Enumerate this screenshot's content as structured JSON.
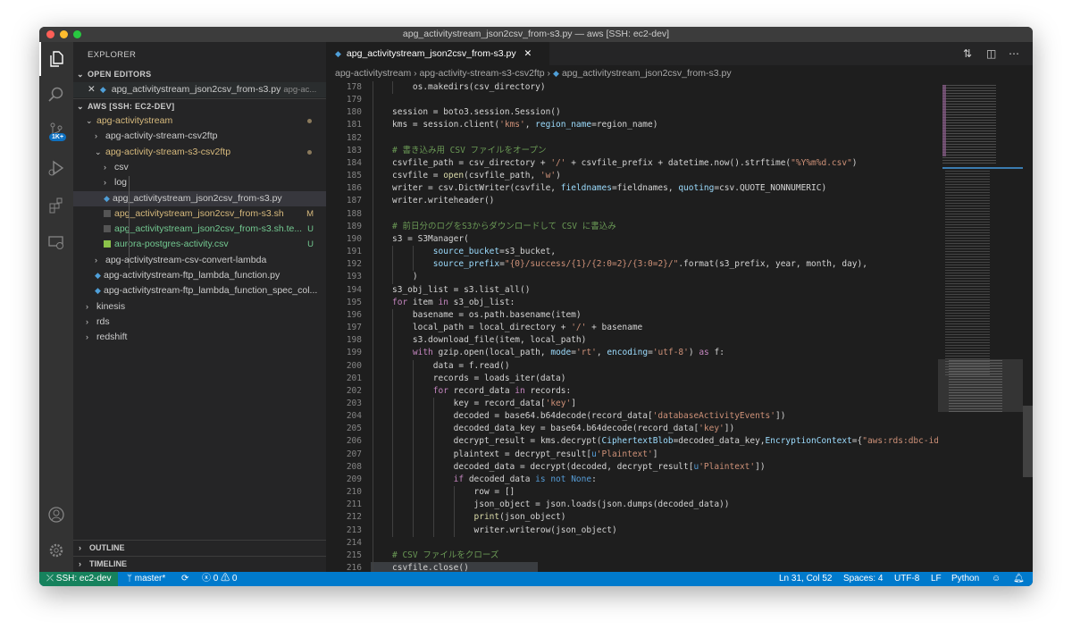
{
  "window": {
    "title": "apg_activitystream_json2csv_from-s3.py — aws [SSH: ec2-dev]"
  },
  "activity_bar": {
    "items": [
      {
        "name": "explorer-icon",
        "active": true
      },
      {
        "name": "search-icon"
      },
      {
        "name": "source-control-icon",
        "badge": "1K+"
      },
      {
        "name": "run-debug-icon"
      },
      {
        "name": "extensions-icon"
      },
      {
        "name": "remote-explorer-icon"
      }
    ],
    "bottom": [
      {
        "name": "account-icon"
      },
      {
        "name": "settings-gear-icon"
      }
    ]
  },
  "sidebar": {
    "title": "EXPLORER",
    "open_editors": {
      "label": "OPEN EDITORS",
      "items": [
        {
          "name": "apg_activitystream_json2csv_from-s3.py",
          "desc": "apg-ac..."
        }
      ]
    },
    "workspace": {
      "label": "AWS [SSH: EC2-DEV]"
    },
    "tree": [
      {
        "label": "apg-activitystream",
        "indent": 1,
        "type": "folder-open",
        "color": "yellow",
        "dot": true
      },
      {
        "label": "apg-activity-stream-csv2ftp",
        "indent": 2,
        "type": "folder"
      },
      {
        "label": "apg-activity-stream-s3-csv2ftp",
        "indent": 2,
        "type": "folder-open",
        "color": "yellow",
        "dot": true
      },
      {
        "label": "csv",
        "indent": 3,
        "type": "folder"
      },
      {
        "label": "log",
        "indent": 3,
        "type": "folder"
      },
      {
        "label": "apg_activitystream_json2csv_from-s3.py",
        "indent": 3,
        "type": "py",
        "selected": true
      },
      {
        "label": "apg_activitystream_json2csv_from-s3.sh",
        "indent": 3,
        "type": "sh",
        "color": "yellow",
        "deco": "M"
      },
      {
        "label": "apg_activitystream_json2csv_from-s3.sh.te...",
        "indent": 3,
        "type": "sh",
        "color": "green",
        "deco": "U"
      },
      {
        "label": "aurora-postgres-activity.csv",
        "indent": 3,
        "type": "csv",
        "color": "green",
        "deco": "U"
      },
      {
        "label": "apg-activitystream-csv-convert-lambda",
        "indent": 2,
        "type": "folder"
      },
      {
        "label": "apg-activitystream-ftp_lambda_function.py",
        "indent": 2,
        "type": "py"
      },
      {
        "label": "apg-activitystream-ftp_lambda_function_spec_col...",
        "indent": 2,
        "type": "py"
      },
      {
        "label": "kinesis",
        "indent": 1,
        "type": "folder"
      },
      {
        "label": "rds",
        "indent": 1,
        "type": "folder"
      },
      {
        "label": "redshift",
        "indent": 1,
        "type": "folder"
      }
    ],
    "outline": "OUTLINE",
    "timeline": "TIMELINE"
  },
  "editor": {
    "tab": {
      "label": "apg_activitystream_json2csv_from-s3.py"
    },
    "actions": [
      {
        "name": "open-changes-icon"
      },
      {
        "name": "split-editor-icon"
      },
      {
        "name": "more-actions-icon"
      }
    ],
    "breadcrumb": [
      "apg-activitystream",
      "apg-activity-stream-s3-csv2ftp",
      "apg_activitystream_json2csv_from-s3.py"
    ],
    "lines": [
      {
        "n": "178",
        "t": [
          [
            "",
            "    os.makedirs(csv_directory)"
          ]
        ]
      },
      {
        "n": "179",
        "t": []
      },
      {
        "n": "180",
        "t": [
          [
            "",
            "session = boto3.session.Session()"
          ]
        ]
      },
      {
        "n": "181",
        "t": [
          [
            "",
            "kms = session.client("
          ],
          [
            "s",
            "'kms'"
          ],
          [
            "",
            ", "
          ],
          [
            "p",
            "region_name"
          ],
          [
            "",
            "=region_name)"
          ]
        ]
      },
      {
        "n": "182",
        "t": []
      },
      {
        "n": "183",
        "t": [
          [
            "c",
            "# 書き込み用 CSV ファイルをオープン"
          ]
        ]
      },
      {
        "n": "184",
        "t": [
          [
            "",
            "csvfile_path = csv_directory + "
          ],
          [
            "s",
            "'/'"
          ],
          [
            "",
            " + csvfile_prefix + datetime.now().strftime("
          ],
          [
            "s",
            "\"%Y%m%d.csv\""
          ],
          [
            "",
            ")"
          ]
        ]
      },
      {
        "n": "185",
        "t": [
          [
            "",
            "csvfile = "
          ],
          [
            "f",
            "open"
          ],
          [
            "",
            "(csvfile_path, "
          ],
          [
            "s",
            "'w'"
          ],
          [
            "",
            ")"
          ]
        ]
      },
      {
        "n": "186",
        "t": [
          [
            "",
            "writer = csv.DictWriter(csvfile, "
          ],
          [
            "p",
            "fieldnames"
          ],
          [
            "",
            "=fieldnames, "
          ],
          [
            "p",
            "quoting"
          ],
          [
            "",
            "=csv.QUOTE_NONNUMERIC)"
          ]
        ]
      },
      {
        "n": "187",
        "t": [
          [
            "",
            "writer.writeheader()"
          ]
        ]
      },
      {
        "n": "188",
        "t": []
      },
      {
        "n": "189",
        "t": [
          [
            "c",
            "# 前日分のログをS3からダウンロードして CSV に書込み"
          ]
        ]
      },
      {
        "n": "190",
        "t": [
          [
            "",
            "s3 = S3Manager("
          ]
        ]
      },
      {
        "n": "191",
        "t": [
          [
            "",
            "        "
          ],
          [
            "p",
            "source_bucket"
          ],
          [
            "",
            "=s3_bucket,"
          ]
        ]
      },
      {
        "n": "192",
        "t": [
          [
            "",
            "        "
          ],
          [
            "p",
            "source_prefix"
          ],
          [
            "",
            "="
          ],
          [
            "s",
            "\"{0}/success/{1}/{2:0=2}/{3:0=2}/\""
          ],
          [
            "",
            ".format(s3_prefix, year, month, day),"
          ]
        ]
      },
      {
        "n": "193",
        "t": [
          [
            "",
            "    )"
          ]
        ]
      },
      {
        "n": "194",
        "t": [
          [
            "",
            "s3_obj_list = s3.list_all()"
          ]
        ]
      },
      {
        "n": "195",
        "t": [
          [
            "k",
            "for"
          ],
          [
            "",
            " item "
          ],
          [
            "k",
            "in"
          ],
          [
            "",
            " s3_obj_list:"
          ]
        ]
      },
      {
        "n": "196",
        "t": [
          [
            "",
            "    basename = os.path.basename(item)"
          ]
        ]
      },
      {
        "n": "197",
        "t": [
          [
            "",
            "    local_path = local_directory + "
          ],
          [
            "s",
            "'/'"
          ],
          [
            "",
            " + basename"
          ]
        ]
      },
      {
        "n": "198",
        "t": [
          [
            "",
            "    s3.download_file(item, local_path)"
          ]
        ]
      },
      {
        "n": "199",
        "t": [
          [
            "",
            "    "
          ],
          [
            "k",
            "with"
          ],
          [
            "",
            " gzip.open(local_path, "
          ],
          [
            "p",
            "mode"
          ],
          [
            "",
            "="
          ],
          [
            "s",
            "'rt'"
          ],
          [
            "",
            ", "
          ],
          [
            "p",
            "encoding"
          ],
          [
            "",
            "="
          ],
          [
            "s",
            "'utf-8'"
          ],
          [
            "",
            ") "
          ],
          [
            "k",
            "as"
          ],
          [
            "",
            " f:"
          ]
        ]
      },
      {
        "n": "200",
        "t": [
          [
            "",
            "        data = f.read()"
          ]
        ]
      },
      {
        "n": "201",
        "t": [
          [
            "",
            "        records = loads_iter(data)"
          ]
        ]
      },
      {
        "n": "202",
        "t": [
          [
            "",
            "        "
          ],
          [
            "k",
            "for"
          ],
          [
            "",
            " record_data "
          ],
          [
            "k",
            "in"
          ],
          [
            "",
            " records:"
          ]
        ]
      },
      {
        "n": "203",
        "t": [
          [
            "",
            "            key = record_data["
          ],
          [
            "s",
            "'key'"
          ],
          [
            "",
            "]"
          ]
        ]
      },
      {
        "n": "204",
        "t": [
          [
            "",
            "            decoded = base64.b64decode(record_data["
          ],
          [
            "s",
            "'databaseActivityEvents'"
          ],
          [
            "",
            "])"
          ]
        ]
      },
      {
        "n": "205",
        "t": [
          [
            "",
            "            decoded_data_key = base64.b64decode(record_data["
          ],
          [
            "s",
            "'key'"
          ],
          [
            "",
            "])"
          ]
        ]
      },
      {
        "n": "206",
        "t": [
          [
            "",
            "            decrypt_result = kms.decrypt("
          ],
          [
            "p",
            "CiphertextBlob"
          ],
          [
            "",
            "=decoded_data_key,"
          ],
          [
            "p",
            "EncryptionContext"
          ],
          [
            "",
            "={"
          ],
          [
            "s",
            "\"aws:rds:dbc-id\""
          ]
        ]
      },
      {
        "n": "207",
        "t": [
          [
            "",
            "            plaintext = decrypt_result["
          ],
          [
            "b",
            "u"
          ],
          [
            "s",
            "'Plaintext'"
          ],
          [
            "",
            "]"
          ]
        ]
      },
      {
        "n": "208",
        "t": [
          [
            "",
            "            decoded_data = decrypt(decoded, decrypt_result["
          ],
          [
            "b",
            "u"
          ],
          [
            "s",
            "'Plaintext'"
          ],
          [
            "",
            "])"
          ]
        ]
      },
      {
        "n": "209",
        "t": [
          [
            "",
            "            "
          ],
          [
            "k",
            "if"
          ],
          [
            "",
            " decoded_data "
          ],
          [
            "b",
            "is not None"
          ],
          [
            "",
            ":"
          ]
        ]
      },
      {
        "n": "210",
        "t": [
          [
            "",
            "                row = []"
          ]
        ]
      },
      {
        "n": "211",
        "t": [
          [
            "",
            "                json_object = json.loads(json.dumps(decoded_data))"
          ]
        ]
      },
      {
        "n": "212",
        "t": [
          [
            "",
            "                "
          ],
          [
            "f",
            "print"
          ],
          [
            "",
            "(json_object)"
          ]
        ]
      },
      {
        "n": "213",
        "t": [
          [
            "",
            "                writer.writerow(json_object)"
          ]
        ]
      },
      {
        "n": "214",
        "t": []
      },
      {
        "n": "215",
        "t": [
          [
            "c",
            "# CSV ファイルをクローズ"
          ]
        ]
      },
      {
        "n": "216",
        "t": [
          [
            "",
            "csvfile.close()"
          ]
        ],
        "current": true
      }
    ]
  },
  "status": {
    "remote": "SSH: ec2-dev",
    "branch": "master*",
    "errors": "0",
    "warnings": "0",
    "position": "Ln 31, Col 52",
    "spaces": "Spaces: 4",
    "encoding": "UTF-8",
    "eol": "LF",
    "language": "Python",
    "colors": {
      "bar": "#007acc",
      "remote": "#16825d"
    }
  }
}
